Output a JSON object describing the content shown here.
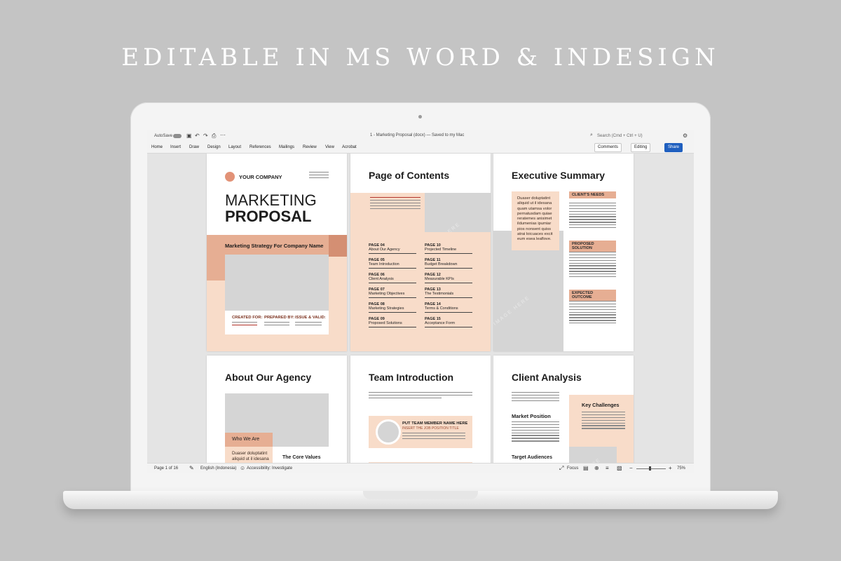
{
  "headline": "EDITABLE IN MS WORD & INDESIGN",
  "word": {
    "autosave": "AutoSave",
    "doc_title": "1 - Marketing Proposal (docx) — Saved to my Mac",
    "search_placeholder": "Search (Cmd + Ctrl + U)",
    "tabs": [
      "Home",
      "Insert",
      "Draw",
      "Design",
      "Layout",
      "References",
      "Mailings",
      "Review",
      "View",
      "Acrobat"
    ],
    "comments": "Comments",
    "editing": "Editing",
    "share": "Share"
  },
  "status": {
    "page": "Page 1 of 16",
    "language": "English (Indonesia)",
    "accessibility": "Accessibility: Investigate",
    "focus": "Focus",
    "zoom": "75%"
  },
  "cover": {
    "company": "YOUR COMPANY",
    "title1": "MARKETING",
    "title2": "PROPOSAL",
    "subtitle": "Marketing Strategy For Company Name",
    "created_for": "CREATED FOR:",
    "prepared_by": "PREPARED BY:",
    "issue": "ISSUE & VALID:"
  },
  "image_placeholder": "IMAGE HERE",
  "contents": {
    "title": "Page of Contents",
    "left": [
      {
        "page": "PAGE 04",
        "name": "About Our Agency"
      },
      {
        "page": "PAGE 05",
        "name": "Team Introduction"
      },
      {
        "page": "PAGE 06",
        "name": "Client Analysis"
      },
      {
        "page": "PAGE 07",
        "name": "Marketing Objectives"
      },
      {
        "page": "PAGE 08",
        "name": "Marketing Strategies"
      },
      {
        "page": "PAGE 09",
        "name": "Proposed Solutions"
      }
    ],
    "right": [
      {
        "page": "PAGE 10",
        "name": "Projected Timeline"
      },
      {
        "page": "PAGE 11",
        "name": "Budget Breakdown"
      },
      {
        "page": "PAGE 12",
        "name": "Measurable KPIs"
      },
      {
        "page": "PAGE 13",
        "name": "The Testimonials"
      },
      {
        "page": "PAGE 14",
        "name": "Terms & Conditions"
      },
      {
        "page": "PAGE 15",
        "name": "Acceptance Form"
      }
    ]
  },
  "exec": {
    "title": "Executive Summary",
    "quote": "Duaser doluptatint aliquid ut il idesana quam utamsa volor pernatusdam quiae reratemes anisimet ildumenias ipumiar pios nonsent quiss atrai loicuaces excit eum esea leaflove.",
    "needs": "CLIENT'S NEEDS",
    "solution": "PROPOSED SOLUTION",
    "outcome": "EXPECTED OUTCOME"
  },
  "about": {
    "title": "About Our Agency",
    "who": "Who We Are",
    "text": "Duaser doluptatint aliquid ut il idesana",
    "core": "The Core Values"
  },
  "team": {
    "title": "Team Introduction",
    "member": "PUT TEAM MEMBER NAME HERE",
    "position": "INSERT THE JOB POSITION TITLE"
  },
  "client": {
    "title": "Client Analysis",
    "challenges": "Key Challenges",
    "market": "Market Position",
    "audiences": "Target Audiences"
  }
}
